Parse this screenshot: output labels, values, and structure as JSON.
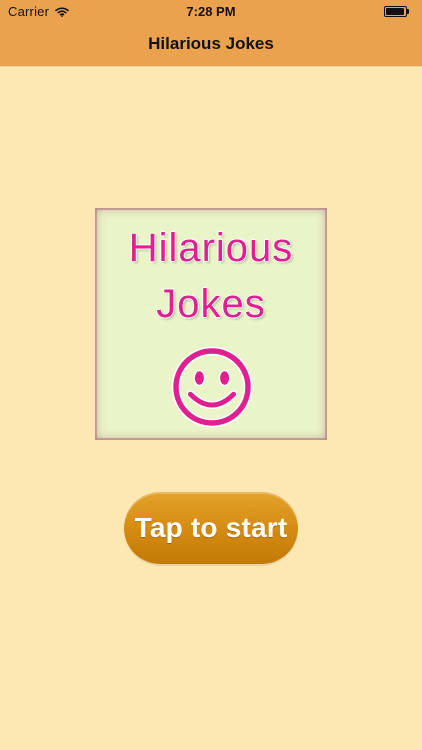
{
  "status_bar": {
    "carrier": "Carrier",
    "time": "7:28 PM",
    "wifi_icon": "wifi-icon",
    "battery_icon": "battery-icon"
  },
  "nav": {
    "title": "Hilarious Jokes"
  },
  "logo": {
    "line1": "Hilarious",
    "line2": "Jokes",
    "icon": "smiley-face-icon",
    "colors": {
      "text": "#e0208e",
      "background": "#e9f4c8"
    }
  },
  "actions": {
    "start_label": "Tap to start"
  },
  "colors": {
    "page_background": "#fde8b3",
    "top_bar": "#eba24f",
    "button": "#d48a10"
  }
}
